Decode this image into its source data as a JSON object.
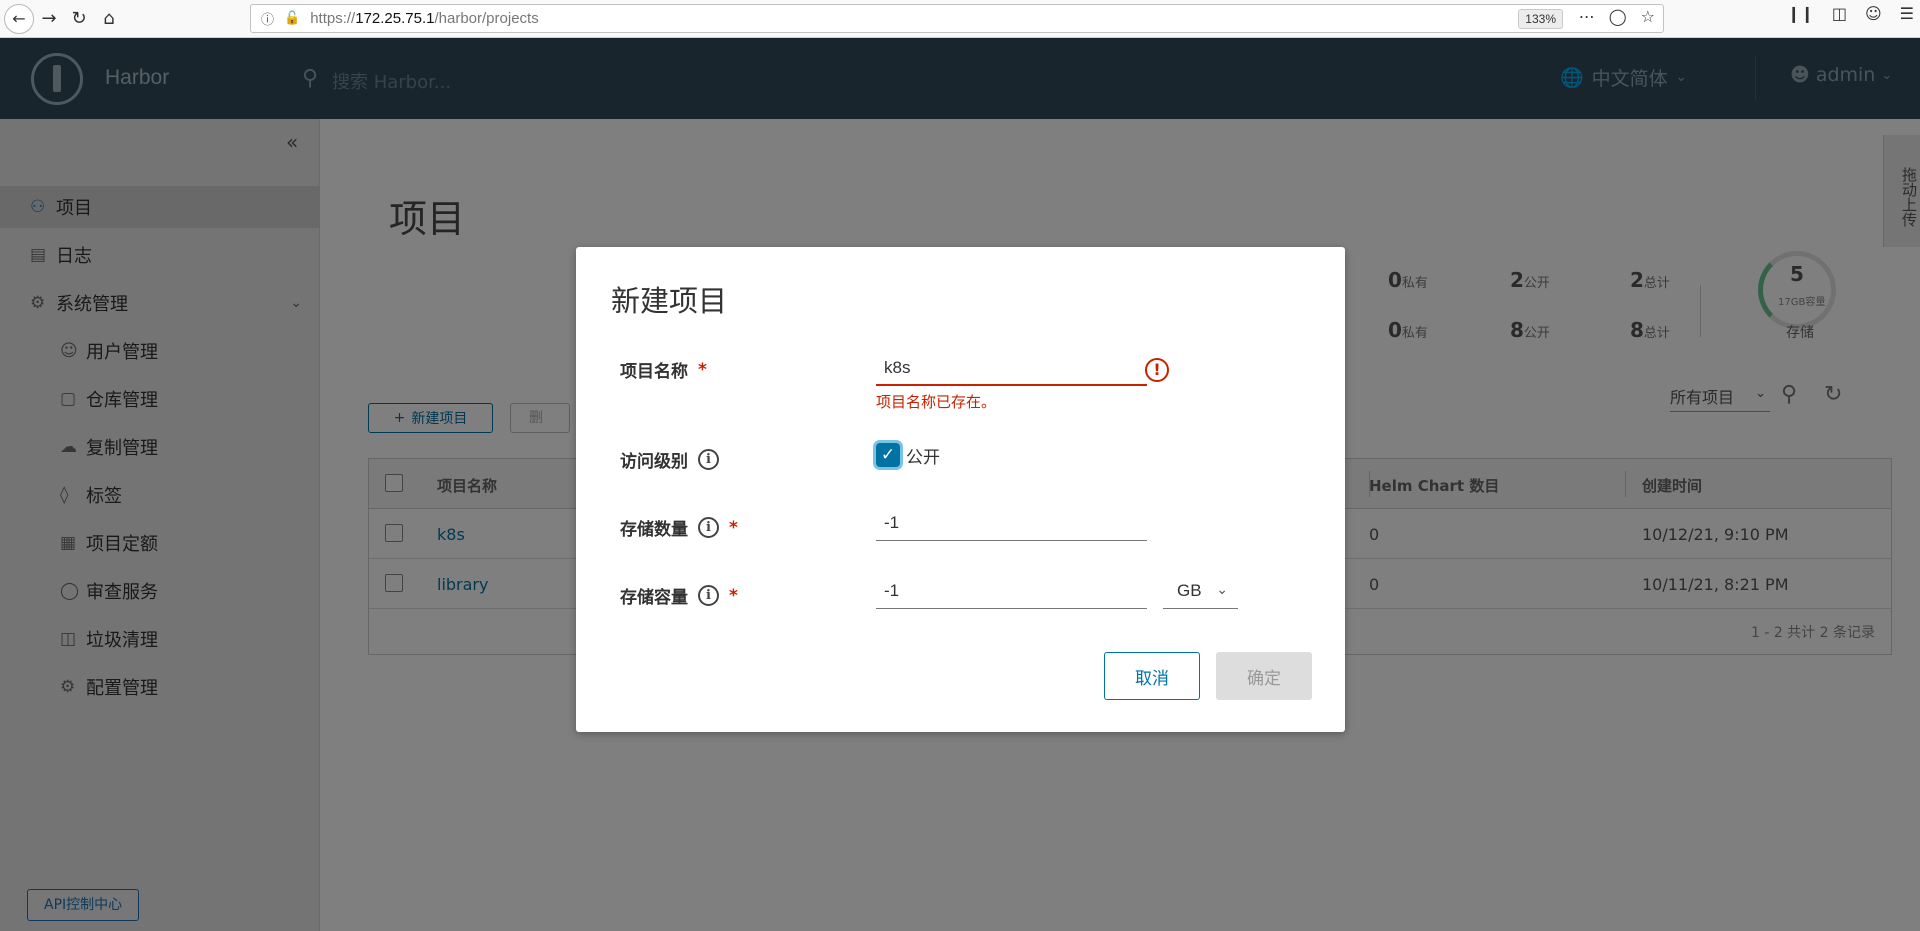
{
  "browser": {
    "url_prefix": "https://",
    "url_host": "172.25.75.1",
    "url_path": "/harbor/projects",
    "zoom": "133%"
  },
  "header": {
    "brand": "Harbor",
    "search_placeholder": "搜索 Harbor...",
    "language": "中文简体",
    "user": "admin"
  },
  "sidebar": {
    "items": [
      {
        "label": "项目",
        "icon": "projects-icon"
      },
      {
        "label": "日志",
        "icon": "logs-icon"
      },
      {
        "label": "系统管理",
        "icon": "admin-icon"
      },
      {
        "label": "用户管理",
        "icon": "users-icon"
      },
      {
        "label": "仓库管理",
        "icon": "registry-icon"
      },
      {
        "label": "复制管理",
        "icon": "replication-icon"
      },
      {
        "label": "标签",
        "icon": "tag-icon"
      },
      {
        "label": "项目定额",
        "icon": "quota-icon"
      },
      {
        "label": "审查服务",
        "icon": "shield-icon"
      },
      {
        "label": "垃圾清理",
        "icon": "trash-icon"
      },
      {
        "label": "配置管理",
        "icon": "gear-icon"
      }
    ],
    "api_button": "API控制中心"
  },
  "main": {
    "title": "项目",
    "stats": {
      "row1": [
        {
          "num": "0",
          "label": "私有"
        },
        {
          "num": "2",
          "label": "公开"
        },
        {
          "num": "2",
          "label": "总计"
        }
      ],
      "row2": [
        {
          "num": "0",
          "label": "私有"
        },
        {
          "num": "8",
          "label": "公开"
        },
        {
          "num": "8",
          "label": "总计"
        }
      ],
      "gauge_num": "5",
      "gauge_caption": "17GB容量",
      "gauge_label": "存储"
    },
    "side_tab": "拖动上传",
    "new_project_button": "新建项目",
    "delete_button": "删",
    "filter_value": "所有项目",
    "table": {
      "headers": [
        "项目名称",
        "Helm Chart 数目",
        "创建时间"
      ],
      "rows": [
        {
          "name": "k8s",
          "helm": "0",
          "created": "10/12/21, 9:10 PM"
        },
        {
          "name": "library",
          "helm": "0",
          "created": "10/11/21, 8:21 PM"
        }
      ],
      "footer": "1 - 2 共计 2 条记录"
    }
  },
  "modal": {
    "title": "新建项目",
    "name_label": "项目名称",
    "name_value": "k8s",
    "name_error": "项目名称已存在。",
    "access_label": "访问级别",
    "public_label": "公开",
    "count_label": "存储数量",
    "count_value": "-1",
    "capacity_label": "存储容量",
    "capacity_value": "-1",
    "capacity_unit": "GB",
    "required_mark": "*",
    "cancel": "取消",
    "ok": "确定"
  },
  "colors": {
    "header_bg": "#314a5a",
    "primary": "#0072a3",
    "error": "#c92100"
  }
}
